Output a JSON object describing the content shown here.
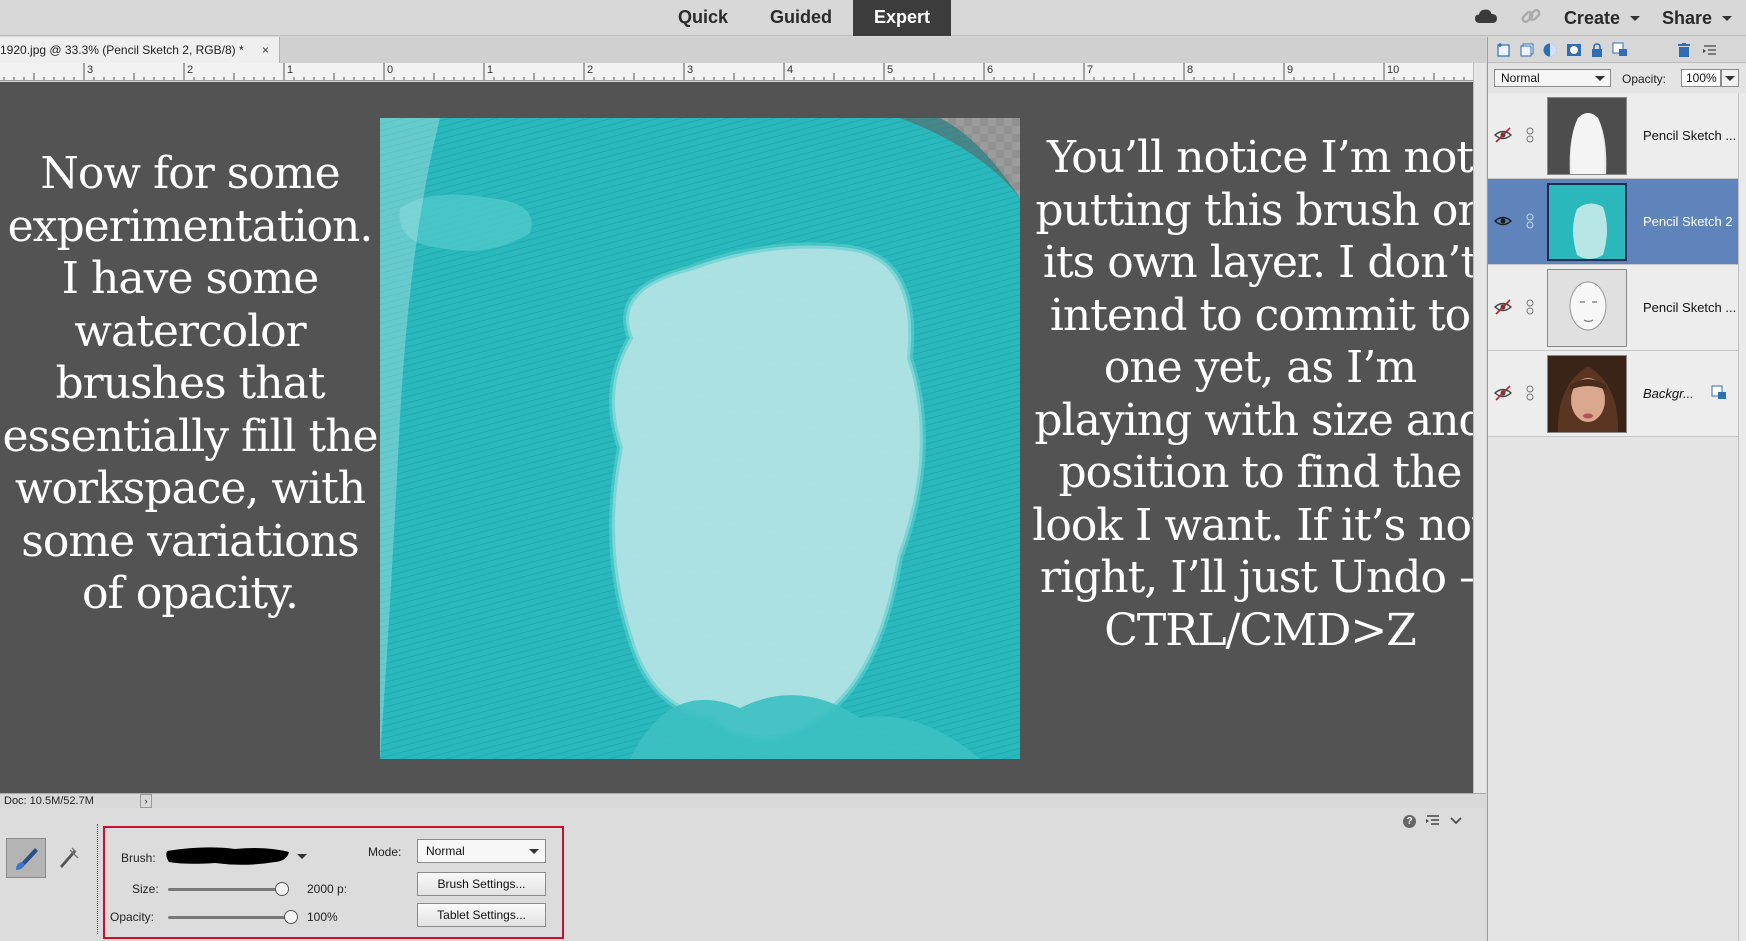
{
  "modes": {
    "quick": "Quick",
    "guided": "Guided",
    "expert": "Expert"
  },
  "top_right": {
    "create": "Create",
    "share": "Share"
  },
  "document_tab": {
    "title": "1920.jpg @ 33.3% (Pencil Sketch 2, RGB/8) *",
    "close": "×"
  },
  "ruler_labels": [
    "3",
    "2",
    "1",
    "0",
    "1",
    "2",
    "3",
    "4",
    "5",
    "6",
    "7",
    "8",
    "9",
    "10"
  ],
  "canvas": {
    "left_text": "Now for some experimentation. I have some watercolor brushes that essentially fill the workspace, with some variations of opacity.",
    "right_text": "You’ll notice I’m not putting this brush on its own layer. I don’t intend to commit to one yet, as I’m playing with size and position to find the look I want. If it’s not right, I’ll just Undo – CTRL/CMD>Z",
    "art_color": "#2abbbf"
  },
  "status": {
    "doc": "Doc: 10.5M/52.7M",
    "arrow": "›"
  },
  "tool_options": {
    "brush_label": "Brush:",
    "mode_label": "Mode:",
    "mode_value": "Normal",
    "size_label": "Size:",
    "size_value": "2000 p:",
    "size_level": 1.0,
    "opacity_label": "Opacity:",
    "opacity_value": "100%",
    "opacity_level": 1.0,
    "brush_settings": "Brush Settings...",
    "tablet_settings": "Tablet Settings...",
    "help": "?"
  },
  "layers_panel": {
    "blend_mode": "Normal",
    "opacity_label": "Opacity:",
    "opacity_value": "100%",
    "layers": [
      {
        "name": "Pencil Sketch ...",
        "visible": false,
        "selected": false
      },
      {
        "name": "Pencil Sketch 2",
        "visible": true,
        "selected": true
      },
      {
        "name": "Pencil Sketch ...",
        "visible": false,
        "selected": false
      },
      {
        "name": "Backgr...",
        "visible": false,
        "selected": false
      }
    ]
  }
}
